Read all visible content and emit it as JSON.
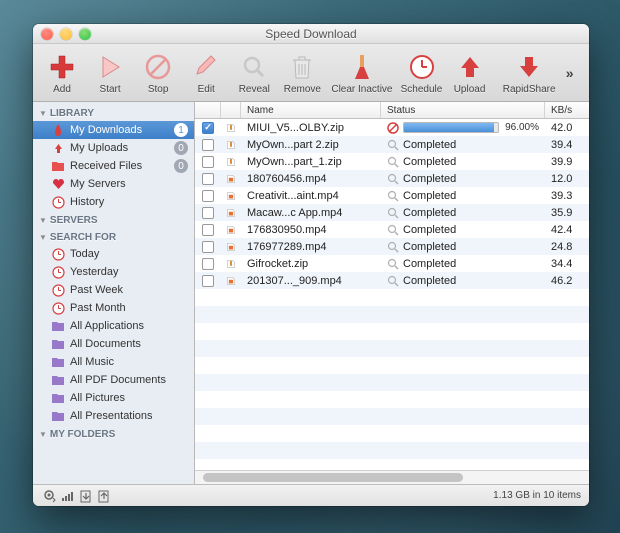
{
  "window": {
    "title": "Speed Download"
  },
  "toolbar": [
    {
      "id": "add",
      "label": "Add"
    },
    {
      "id": "start",
      "label": "Start"
    },
    {
      "id": "stop",
      "label": "Stop"
    },
    {
      "id": "edit",
      "label": "Edit"
    },
    {
      "id": "reveal",
      "label": "Reveal"
    },
    {
      "id": "remove",
      "label": "Remove"
    },
    {
      "id": "clear",
      "label": "Clear Inactive"
    },
    {
      "id": "schedule",
      "label": "Schedule"
    },
    {
      "id": "upload",
      "label": "Upload"
    },
    {
      "id": "rapidshare",
      "label": "RapidShare"
    }
  ],
  "sidebar": {
    "sections": [
      {
        "title": "LIBRARY",
        "items": [
          {
            "icon": "flame",
            "label": "My Downloads",
            "badge": "1",
            "selected": true
          },
          {
            "icon": "upload-s",
            "label": "My Uploads",
            "badge": "0"
          },
          {
            "icon": "folder-red",
            "label": "Received Files",
            "badge": "0"
          },
          {
            "icon": "heart",
            "label": "My Servers"
          },
          {
            "icon": "clock-red",
            "label": "History"
          }
        ]
      },
      {
        "title": "SERVERS",
        "items": []
      },
      {
        "title": "SEARCH FOR",
        "items": [
          {
            "icon": "clock-red",
            "label": "Today"
          },
          {
            "icon": "clock-red",
            "label": "Yesterday"
          },
          {
            "icon": "clock-red",
            "label": "Past Week"
          },
          {
            "icon": "clock-red",
            "label": "Past Month"
          },
          {
            "icon": "folder-p",
            "label": "All Applications"
          },
          {
            "icon": "folder-p",
            "label": "All Documents"
          },
          {
            "icon": "folder-p",
            "label": "All Music"
          },
          {
            "icon": "folder-p",
            "label": "All PDF Documents"
          },
          {
            "icon": "folder-p",
            "label": "All Pictures"
          },
          {
            "icon": "folder-p",
            "label": "All Presentations"
          }
        ]
      },
      {
        "title": "MY FOLDERS",
        "items": []
      }
    ]
  },
  "columns": {
    "check": "",
    "name": "Name",
    "status": "Status",
    "kbs": "KB/s"
  },
  "files": [
    {
      "checked": true,
      "type": "zip",
      "name": "MIUI_V5...OLBY.zip",
      "status": "progress",
      "progress": 96.0,
      "progress_text": "96.00%",
      "kbs": "42.0"
    },
    {
      "checked": false,
      "type": "zip",
      "name": "MyOwn...part 2.zip",
      "status": "completed",
      "status_text": "Completed",
      "kbs": "39.4"
    },
    {
      "checked": false,
      "type": "zip",
      "name": "MyOwn...part_1.zip",
      "status": "completed",
      "status_text": "Completed",
      "kbs": "39.9"
    },
    {
      "checked": false,
      "type": "mp4",
      "name": "180760456.mp4",
      "status": "completed",
      "status_text": "Completed",
      "kbs": "12.0"
    },
    {
      "checked": false,
      "type": "mp4",
      "name": "Creativit...aint.mp4",
      "status": "completed",
      "status_text": "Completed",
      "kbs": "39.3"
    },
    {
      "checked": false,
      "type": "mp4",
      "name": "Macaw...c App.mp4",
      "status": "completed",
      "status_text": "Completed",
      "kbs": "35.9"
    },
    {
      "checked": false,
      "type": "mp4",
      "name": "176830950.mp4",
      "status": "completed",
      "status_text": "Completed",
      "kbs": "42.4"
    },
    {
      "checked": false,
      "type": "mp4",
      "name": "176977289.mp4",
      "status": "completed",
      "status_text": "Completed",
      "kbs": "24.8"
    },
    {
      "checked": false,
      "type": "zip",
      "name": "Gifrocket.zip",
      "status": "completed",
      "status_text": "Completed",
      "kbs": "34.4"
    },
    {
      "checked": false,
      "type": "mp4",
      "name": "201307..._909.mp4",
      "status": "completed",
      "status_text": "Completed",
      "kbs": "46.2"
    }
  ],
  "statusbar": {
    "text": "1.13 GB in 10 items"
  }
}
